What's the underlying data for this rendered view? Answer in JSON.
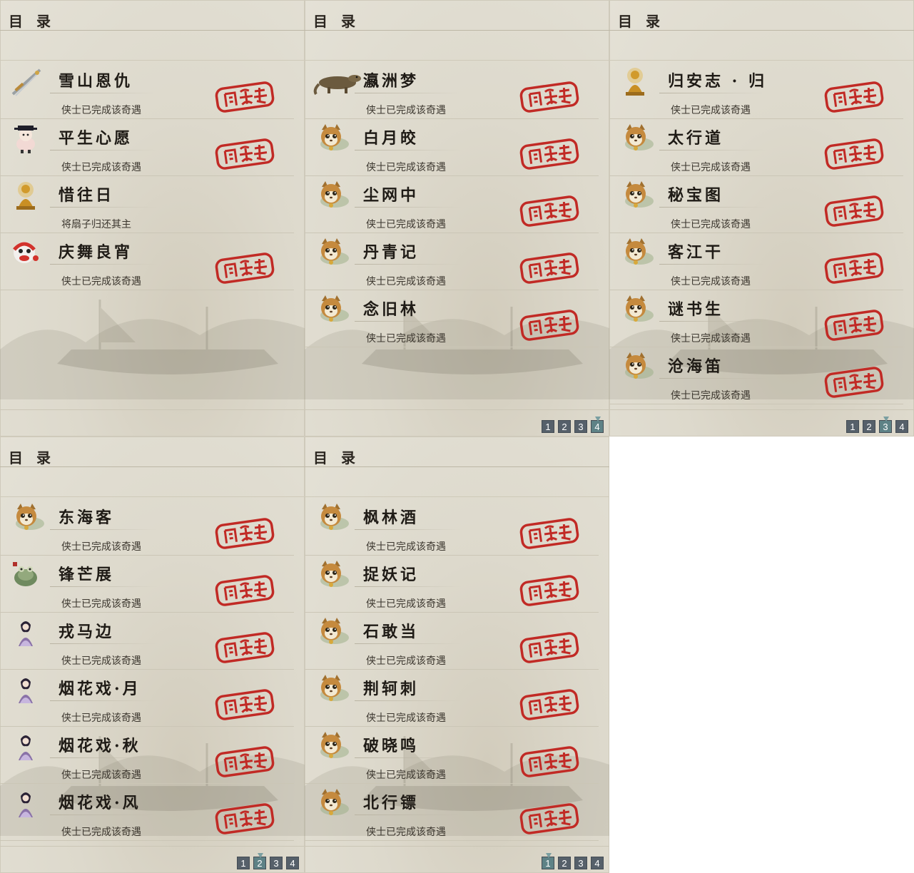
{
  "colors": {
    "stamp_red": "#c12a25",
    "panel_bg": "#e2dfd4",
    "pager_bg": "#56606a",
    "pager_active": "#5e8286"
  },
  "panels": [
    {
      "title": "目 录",
      "entries": [
        {
          "icon": "sword-icon",
          "name": "雪山恩仇",
          "status": "侠士已完成该奇遇",
          "completed": true
        },
        {
          "icon": "official-figure-icon",
          "name": "平生心愿",
          "status": "侠士已完成该奇遇",
          "completed": true
        },
        {
          "icon": "golden-buddha-icon",
          "name": "惜往日",
          "status": "将扇子归还其主",
          "completed": false
        },
        {
          "icon": "lion-dance-icon",
          "name": "庆舞良宵",
          "status": "侠士已完成该奇遇",
          "completed": true
        }
      ],
      "pager": null
    },
    {
      "title": "目 录",
      "entries": [
        {
          "icon": "lizard-icon",
          "name": "瀛洲梦",
          "status": "侠士已完成该奇遇",
          "completed": true
        },
        {
          "icon": "cat-pet-icon",
          "name": "白月皎",
          "status": "侠士已完成该奇遇",
          "completed": true
        },
        {
          "icon": "cat-pet-icon",
          "name": "尘网中",
          "status": "侠士已完成该奇遇",
          "completed": true
        },
        {
          "icon": "cat-pet-icon",
          "name": "丹青记",
          "status": "侠士已完成该奇遇",
          "completed": true
        },
        {
          "icon": "cat-pet-icon",
          "name": "念旧林",
          "status": "侠士已完成该奇遇",
          "completed": true
        }
      ],
      "pager": {
        "pages": [
          "1",
          "2",
          "3",
          "4"
        ],
        "active": 3
      }
    },
    {
      "title": "目 录",
      "entries": [
        {
          "icon": "golden-buddha-icon",
          "name": "归安志 · 归",
          "status": "侠士已完成该奇遇",
          "completed": true
        },
        {
          "icon": "cat-pet-icon",
          "name": "太行道",
          "status": "侠士已完成该奇遇",
          "completed": true
        },
        {
          "icon": "cat-pet-icon",
          "name": "秘宝图",
          "status": "侠士已完成该奇遇",
          "completed": true
        },
        {
          "icon": "cat-pet-icon",
          "name": "客江干",
          "status": "侠士已完成该奇遇",
          "completed": true
        },
        {
          "icon": "cat-pet-icon",
          "name": "谜书生",
          "status": "侠士已完成该奇遇",
          "completed": true
        },
        {
          "icon": "cat-pet-icon",
          "name": "沧海笛",
          "status": "侠士已完成该奇遇",
          "completed": true
        }
      ],
      "pager": {
        "pages": [
          "1",
          "2",
          "3",
          "4"
        ],
        "active": 2
      }
    },
    {
      "title": "目 录",
      "entries": [
        {
          "icon": "cat-pet-icon",
          "name": "东海客",
          "status": "侠士已完成该奇遇",
          "completed": true
        },
        {
          "icon": "jade-frog-icon",
          "name": "锋芒展",
          "status": "侠士已完成该奇遇",
          "completed": true
        },
        {
          "icon": "lady-figure-icon",
          "name": "戎马边",
          "status": "侠士已完成该奇遇",
          "completed": true
        },
        {
          "icon": "lady-figure-icon",
          "name": "烟花戏·月",
          "status": "侠士已完成该奇遇",
          "completed": true
        },
        {
          "icon": "lady-figure-icon",
          "name": "烟花戏·秋",
          "status": "侠士已完成该奇遇",
          "completed": true
        },
        {
          "icon": "lady-figure-icon",
          "name": "烟花戏·风",
          "status": "侠士已完成该奇遇",
          "completed": true
        }
      ],
      "pager": {
        "pages": [
          "1",
          "2",
          "3",
          "4"
        ],
        "active": 1
      }
    },
    {
      "title": "目 录",
      "entries": [
        {
          "icon": "cat-pet-icon",
          "name": "枫林酒",
          "status": "侠士已完成该奇遇",
          "completed": true
        },
        {
          "icon": "cat-pet-icon",
          "name": "捉妖记",
          "status": "侠士已完成该奇遇",
          "completed": true
        },
        {
          "icon": "cat-pet-icon",
          "name": "石敢当",
          "status": "侠士已完成该奇遇",
          "completed": true
        },
        {
          "icon": "cat-pet-icon",
          "name": "荆轲刺",
          "status": "侠士已完成该奇遇",
          "completed": true
        },
        {
          "icon": "cat-pet-icon",
          "name": "破晓鸣",
          "status": "侠士已完成该奇遇",
          "completed": true
        },
        {
          "icon": "cat-pet-icon",
          "name": "北行镖",
          "status": "侠士已完成该奇遇",
          "completed": true
        }
      ],
      "pager": {
        "pages": [
          "1",
          "2",
          "3",
          "4"
        ],
        "active": 0
      }
    }
  ]
}
